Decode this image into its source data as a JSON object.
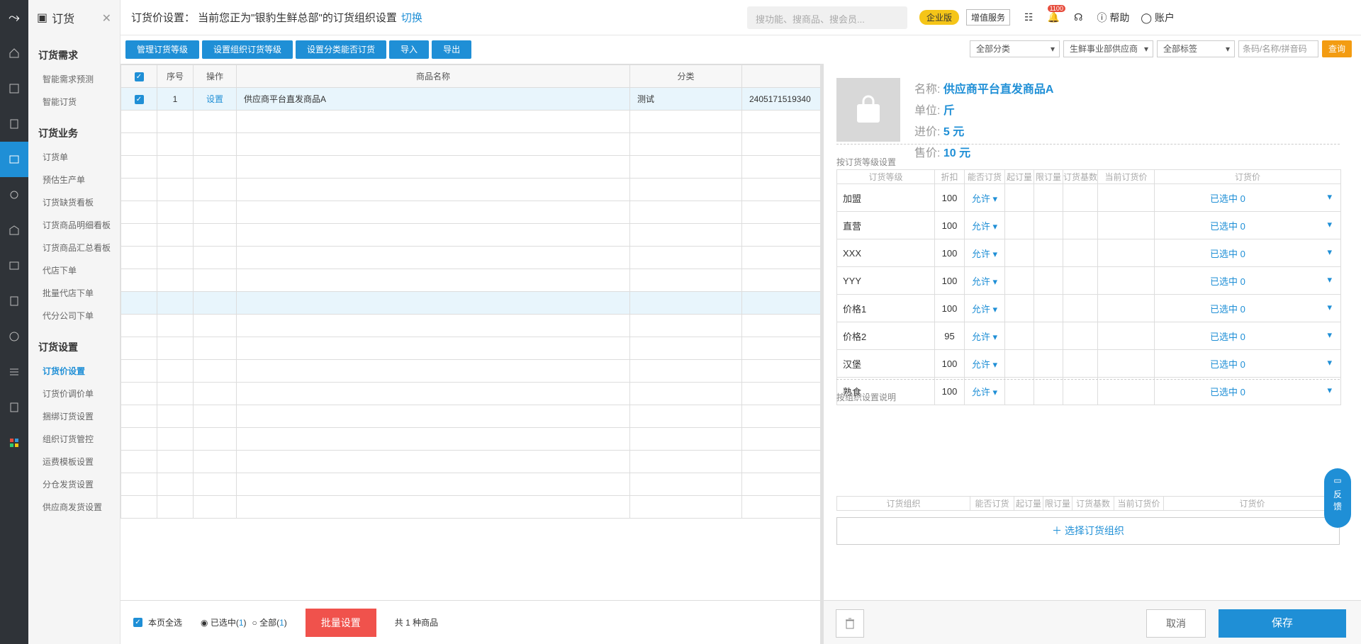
{
  "sidebar": {
    "title": "订货",
    "groups": [
      {
        "label": "订货需求",
        "items": [
          {
            "label": "智能需求预测"
          },
          {
            "label": "智能订货"
          }
        ]
      },
      {
        "label": "订货业务",
        "items": [
          {
            "label": "订货单"
          },
          {
            "label": "预估生产单"
          },
          {
            "label": "订货缺货看板"
          },
          {
            "label": "订货商品明细看板"
          },
          {
            "label": "订货商品汇总看板"
          },
          {
            "label": "代店下单"
          },
          {
            "label": "批量代店下单"
          },
          {
            "label": "代分公司下单"
          }
        ]
      },
      {
        "label": "订货设置",
        "items": [
          {
            "label": "订货价设置"
          },
          {
            "label": "订货价调价单"
          },
          {
            "label": "捆绑订货设置"
          },
          {
            "label": "组织订货管控"
          },
          {
            "label": "运费模板设置"
          },
          {
            "label": "分仓发货设置"
          },
          {
            "label": "供应商发货设置"
          }
        ]
      }
    ],
    "active": "订货价设置"
  },
  "header": {
    "title": "订货价设置： 当前您正为\"银豹生鲜总部\"的订货组织设置",
    "switch_label": "切换",
    "search_placeholder": "搜功能、搜商品、搜会员...",
    "enterprise_badge": "企业版",
    "value_service": "增值服务",
    "notification_count": "1100",
    "help_label": "帮助",
    "account_label": "账户"
  },
  "toolbar": {
    "buttons": [
      "管理订货等级",
      "设置组织订货等级",
      "设置分类能否订货",
      "导入",
      "导出"
    ]
  },
  "filters": {
    "category": "全部分类",
    "supplier": "生鲜事业部供应商",
    "tag": "全部标签",
    "search_placeholder": "条码/名称/拼音码",
    "query": "查询"
  },
  "table": {
    "headers": [
      "序号",
      "操作",
      "商品名称",
      "分类",
      ""
    ],
    "rows": [
      {
        "index": "1",
        "action": "设置",
        "name": "供应商平台直发商品A",
        "category": "测试",
        "code": "2405171519340"
      }
    ]
  },
  "bottom": {
    "select_page": "本页全选",
    "selected_label": "已选中(",
    "selected_count": "1",
    "all_label": "全部(",
    "all_count": "1",
    "close_paren": ")",
    "batch": "批量设置",
    "total": "共 1 种商品"
  },
  "detail": {
    "name_label": "名称:",
    "name": "供应商平台直发商品A",
    "unit_label": "单位:",
    "unit": "斤",
    "cost_label": "进价:",
    "cost": "5 元",
    "price_label": "售价:",
    "price": "10 元",
    "level_section": "按订货等级设置",
    "level_headers": [
      "订货等级",
      "折扣",
      "能否订货",
      "起订量",
      "限订量",
      "订货基数",
      "当前订货价",
      "订货价"
    ],
    "levels": [
      {
        "name": "加盟",
        "discount": "100",
        "allow": "允许",
        "price": "已选中 0"
      },
      {
        "name": "直营",
        "discount": "100",
        "allow": "允许",
        "price": "已选中 0"
      },
      {
        "name": "XXX",
        "discount": "100",
        "allow": "允许",
        "price": "已选中 0"
      },
      {
        "name": "YYY",
        "discount": "100",
        "allow": "允许",
        "price": "已选中 0"
      },
      {
        "name": "价格1",
        "discount": "100",
        "allow": "允许",
        "price": "已选中 0"
      },
      {
        "name": "价格2",
        "discount": "95",
        "allow": "允许",
        "price": "已选中 0"
      },
      {
        "name": "汉堡",
        "discount": "100",
        "allow": "允许",
        "price": "已选中 0"
      },
      {
        "name": "熟食",
        "discount": "100",
        "allow": "允许",
        "price": "已选中 0"
      }
    ],
    "org_section": "按组织设置说明",
    "org_headers": [
      "订货组织",
      "能否订货",
      "起订量",
      "限订量",
      "订货基数",
      "当前订货价",
      "订货价"
    ],
    "add_org": "选择订货组织",
    "cancel": "取消",
    "save": "保存"
  },
  "feedback": "反馈"
}
